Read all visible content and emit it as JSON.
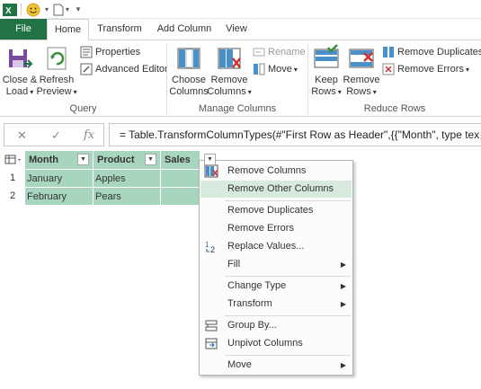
{
  "quick_access": {
    "customize_symbol": "▾"
  },
  "tabs": [
    {
      "label": "File"
    },
    {
      "label": "Home"
    },
    {
      "label": "Transform"
    },
    {
      "label": "Add Column"
    },
    {
      "label": "View"
    }
  ],
  "ribbon": {
    "query": {
      "group_label": "Query",
      "close_load": "Close &\nLoad",
      "refresh_preview": "Refresh\nPreview",
      "properties": "Properties",
      "advanced_editor": "Advanced Editor"
    },
    "manage_columns": {
      "group_label": "Manage Columns",
      "choose_columns": "Choose\nColumns",
      "remove_columns": "Remove\nColumns",
      "rename": "Rename",
      "move": "Move"
    },
    "reduce_rows": {
      "group_label": "Reduce Rows",
      "keep_rows": "Keep\nRows",
      "remove_rows": "Remove\nRows",
      "remove_duplicates": "Remove Duplicates",
      "remove_errors": "Remove Errors"
    }
  },
  "formula_bar": {
    "cancel_symbol": "✕",
    "confirm_symbol": "✓",
    "fx_label": "fx",
    "formula": "= Table.TransformColumnTypes(#\"First Row as Header\",{{\"Month\", type tex"
  },
  "grid": {
    "columns": [
      "Month",
      "Product",
      "Sales"
    ],
    "rows": [
      {
        "num": "1",
        "cells": [
          "January",
          "Apples",
          ""
        ]
      },
      {
        "num": "2",
        "cells": [
          "February",
          "Pears",
          ""
        ]
      }
    ]
  },
  "context_menu": {
    "items": [
      {
        "label": "Remove Columns",
        "icon": "remove-columns-icon",
        "submenu": false
      },
      {
        "label": "Remove Other Columns",
        "icon": "",
        "submenu": false,
        "highlighted": true
      },
      {
        "label": "Remove Duplicates",
        "icon": "",
        "submenu": false
      },
      {
        "label": "Remove Errors",
        "icon": "",
        "submenu": false
      },
      {
        "label": "Replace Values...",
        "icon": "replace-values-icon",
        "submenu": false
      },
      {
        "label": "Fill",
        "icon": "",
        "submenu": true
      },
      {
        "label": "Change Type",
        "icon": "",
        "submenu": true
      },
      {
        "label": "Transform",
        "icon": "",
        "submenu": true
      },
      {
        "label": "Group By...",
        "icon": "group-by-icon",
        "submenu": false
      },
      {
        "label": "Unpivot Columns",
        "icon": "unpivot-icon",
        "submenu": false
      },
      {
        "label": "Move",
        "icon": "",
        "submenu": true
      }
    ],
    "submenu_arrow": "▶"
  },
  "colors": {
    "excel_green": "#217346",
    "selection_green": "#a8d5bd",
    "menu_highlight": "#d7eadd"
  }
}
